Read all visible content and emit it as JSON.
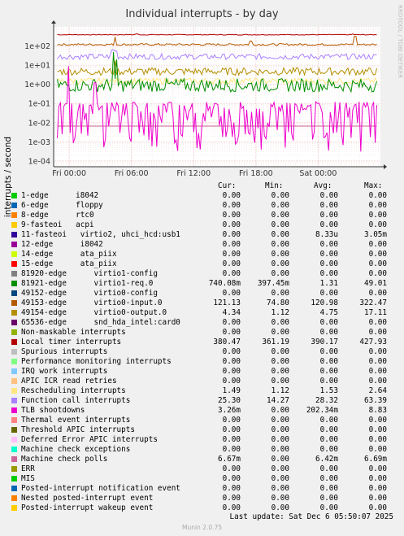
{
  "title": "Individual interrupts - by day",
  "side_credit": "RRDTOOL / TOBI OETIKER",
  "footer": "Munin 2.0.75",
  "last_update": "Last update: Sat Dec  6 05:50:07 2025",
  "legend_headers": {
    "cur": "Cur:",
    "min": "Min:",
    "avg": "Avg:",
    "max": "Max:"
  },
  "legend": [
    {
      "label": "1-edge      i8042",
      "color": "#00cc00",
      "cur": "0.00",
      "min": "0.00",
      "avg": "0.00",
      "max": "0.00"
    },
    {
      "label": "6-edge      floppy",
      "color": "#0066b3",
      "cur": "0.00",
      "min": "0.00",
      "avg": "0.00",
      "max": "0.00"
    },
    {
      "label": "8-edge      rtc0",
      "color": "#ff8000",
      "cur": "0.00",
      "min": "0.00",
      "avg": "0.00",
      "max": "0.00"
    },
    {
      "label": "9-fasteoi   acpi",
      "color": "#ffcc00",
      "cur": "0.00",
      "min": "0.00",
      "avg": "0.00",
      "max": "0.00"
    },
    {
      "label": "11-fasteoi   virtio2, uhci_hcd:usb1",
      "color": "#330099",
      "cur": "0.00",
      "min": "0.00",
      "avg": "8.33u",
      "max": "3.05m"
    },
    {
      "label": "12-edge      i8042",
      "color": "#990099",
      "cur": "0.00",
      "min": "0.00",
      "avg": "0.00",
      "max": "0.00"
    },
    {
      "label": "14-edge      ata_piix",
      "color": "#ccff00",
      "cur": "0.00",
      "min": "0.00",
      "avg": "0.00",
      "max": "0.00"
    },
    {
      "label": "15-edge      ata_piix",
      "color": "#ff0000",
      "cur": "0.00",
      "min": "0.00",
      "avg": "0.00",
      "max": "0.00"
    },
    {
      "label": "81920-edge      virtio1-config",
      "color": "#808080",
      "cur": "0.00",
      "min": "0.00",
      "avg": "0.00",
      "max": "0.00"
    },
    {
      "label": "81921-edge      virtio1-req.0",
      "color": "#008f00",
      "cur": "740.08m",
      "min": "397.45m",
      "avg": "1.31",
      "max": "49.01"
    },
    {
      "label": "49152-edge      virtio0-config",
      "color": "#00487d",
      "cur": "0.00",
      "min": "0.00",
      "avg": "0.00",
      "max": "0.00"
    },
    {
      "label": "49153-edge      virtio0-input.0",
      "color": "#b35a00",
      "cur": "121.13",
      "min": "74.80",
      "avg": "120.98",
      "max": "322.47"
    },
    {
      "label": "49154-edge      virtio0-output.0",
      "color": "#b38f00",
      "cur": "4.34",
      "min": "1.12",
      "avg": "4.75",
      "max": "17.11"
    },
    {
      "label": "65536-edge      snd_hda_intel:card0",
      "color": "#6b006b",
      "cur": "0.00",
      "min": "0.00",
      "avg": "0.00",
      "max": "0.00"
    },
    {
      "label": "Non-maskable interrupts",
      "color": "#8fb300",
      "cur": "0.00",
      "min": "0.00",
      "avg": "0.00",
      "max": "0.00"
    },
    {
      "label": "Local timer interrupts",
      "color": "#b30000",
      "cur": "380.47",
      "min": "361.19",
      "avg": "390.17",
      "max": "427.93"
    },
    {
      "label": "Spurious interrupts",
      "color": "#bebebe",
      "cur": "0.00",
      "min": "0.00",
      "avg": "0.00",
      "max": "0.00"
    },
    {
      "label": "Performance monitoring interrupts",
      "color": "#80ff80",
      "cur": "0.00",
      "min": "0.00",
      "avg": "0.00",
      "max": "0.00"
    },
    {
      "label": "IRQ work interrupts",
      "color": "#80c9ff",
      "cur": "0.00",
      "min": "0.00",
      "avg": "0.00",
      "max": "0.00"
    },
    {
      "label": "APIC ICR read retries",
      "color": "#ffc080",
      "cur": "0.00",
      "min": "0.00",
      "avg": "0.00",
      "max": "0.00"
    },
    {
      "label": "Rescheduling interrupts",
      "color": "#ffe680",
      "cur": "1.49",
      "min": "1.12",
      "avg": "1.53",
      "max": "2.64"
    },
    {
      "label": "Function call interrupts",
      "color": "#aa80ff",
      "cur": "25.30",
      "min": "14.27",
      "avg": "28.32",
      "max": "63.39"
    },
    {
      "label": "TLB shootdowns",
      "color": "#ee00cc",
      "cur": "3.26m",
      "min": "0.00",
      "avg": "202.34m",
      "max": "8.83"
    },
    {
      "label": "Thermal event interrupts",
      "color": "#ff8080",
      "cur": "0.00",
      "min": "0.00",
      "avg": "0.00",
      "max": "0.00"
    },
    {
      "label": "Threshold APIC interrupts",
      "color": "#666600",
      "cur": "0.00",
      "min": "0.00",
      "avg": "0.00",
      "max": "0.00"
    },
    {
      "label": "Deferred Error APIC interrupts",
      "color": "#ffbfff",
      "cur": "0.00",
      "min": "0.00",
      "avg": "0.00",
      "max": "0.00"
    },
    {
      "label": "Machine check exceptions",
      "color": "#00ffcc",
      "cur": "0.00",
      "min": "0.00",
      "avg": "0.00",
      "max": "0.00"
    },
    {
      "label": "Machine check polls",
      "color": "#cc6699",
      "cur": "6.67m",
      "min": "0.00",
      "avg": "6.42m",
      "max": "6.69m"
    },
    {
      "label": "ERR",
      "color": "#999900",
      "cur": "0.00",
      "min": "0.00",
      "avg": "0.00",
      "max": "0.00"
    },
    {
      "label": "MIS",
      "color": "#00cc00",
      "cur": "0.00",
      "min": "0.00",
      "avg": "0.00",
      "max": "0.00"
    },
    {
      "label": "Posted-interrupt notification event",
      "color": "#0066b3",
      "cur": "0.00",
      "min": "0.00",
      "avg": "0.00",
      "max": "0.00"
    },
    {
      "label": "Nested posted-interrupt event",
      "color": "#ff8000",
      "cur": "0.00",
      "min": "0.00",
      "avg": "0.00",
      "max": "0.00"
    },
    {
      "label": "Posted-interrupt wakeup event",
      "color": "#ffcc00",
      "cur": "0.00",
      "min": "0.00",
      "avg": "0.00",
      "max": "0.00"
    }
  ],
  "chart_data": {
    "type": "line",
    "title": "Individual interrupts - by day",
    "ylabel": "interrupts / second",
    "yscale": "log",
    "ylim": [
      5e-05,
      1000
    ],
    "yticks": [
      0.0001,
      0.001,
      0.01,
      0.1,
      1,
      10,
      100
    ],
    "ytick_labels": [
      "1e-04",
      "1e-03",
      "1e-02",
      "1e-01",
      "1e+00",
      "1e+01",
      "1e+02"
    ],
    "xlim_hours": [
      -25.5,
      6.0
    ],
    "xticks_hours": [
      -24,
      -18,
      -12,
      -6,
      0
    ],
    "xtick_labels": [
      "Fri 00:00",
      "Fri 06:00",
      "Fri 12:00",
      "Fri 18:00",
      "Sat 00:00"
    ],
    "grid": true,
    "series": [
      {
        "name": "Local timer interrupts",
        "color": "#b30000",
        "level": 390,
        "noise": 0.02,
        "spike": [
          [
            -17.5,
            425
          ],
          [
            3.3,
            428
          ]
        ]
      },
      {
        "name": "49153-edge      virtio0-input.0",
        "color": "#b35a00",
        "level": 120,
        "noise": 0.05,
        "spike": [
          [
            -19.6,
            300
          ],
          [
            -6.5,
            180
          ],
          [
            3.6,
            322
          ]
        ]
      },
      {
        "name": "Function call interrupts",
        "color": "#aa80ff",
        "level": 28,
        "noise": 0.15,
        "spike": [
          [
            -19.8,
            63
          ],
          [
            -19.5,
            55
          ]
        ]
      },
      {
        "name": "49154-edge      virtio0-output.0",
        "color": "#b38f00",
        "level": 4.7,
        "noise": 0.2,
        "spike": [
          [
            -19.6,
            17
          ]
        ]
      },
      {
        "name": "Rescheduling interrupts",
        "color": "#ffe680",
        "level": 1.5,
        "noise": 0.15,
        "spike": []
      },
      {
        "name": "81921-edge      virtio1-req.0",
        "color": "#008f00",
        "level": 0.9,
        "noise": 0.35,
        "spike": [
          [
            -19.7,
            49
          ],
          [
            -19.4,
            20
          ]
        ]
      },
      {
        "name": "Machine check polls",
        "color": "#cc6699",
        "level": 0.0066,
        "noise": 0.0,
        "spike": []
      },
      {
        "name": "TLB shootdowns",
        "color": "#ee00cc",
        "level": 0.02,
        "noise": 1.2,
        "spike": [
          [
            -24.1,
            8.8
          ],
          [
            -21.5,
            1.2
          ]
        ]
      }
    ]
  }
}
